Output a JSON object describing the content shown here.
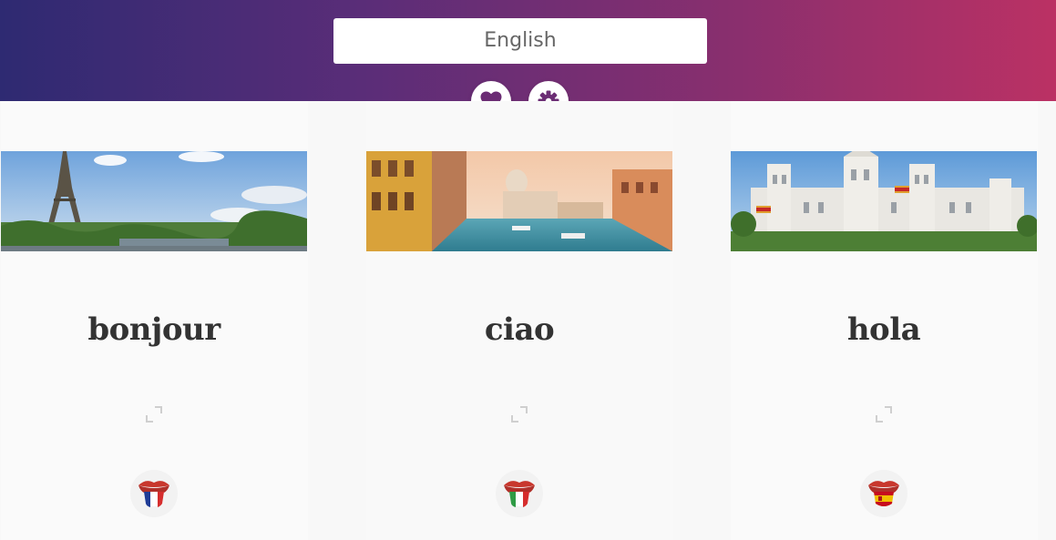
{
  "header": {
    "language_value": "English",
    "favorites_icon": "heart-icon",
    "settings_icon": "gear-icon",
    "accent_color": "#6b2c74",
    "gradient": [
      "#2e2a72",
      "#bb3164"
    ]
  },
  "cards": [
    {
      "word": "bonjour",
      "image": "paris-eiffel-tower",
      "flag": "france",
      "expand_icon": "expand-icon"
    },
    {
      "word": "ciao",
      "image": "venice-grand-canal",
      "flag": "italy",
      "expand_icon": "expand-icon"
    },
    {
      "word": "hola",
      "image": "madrid-cibeles-palace",
      "flag": "spain",
      "expand_icon": "expand-icon"
    }
  ]
}
